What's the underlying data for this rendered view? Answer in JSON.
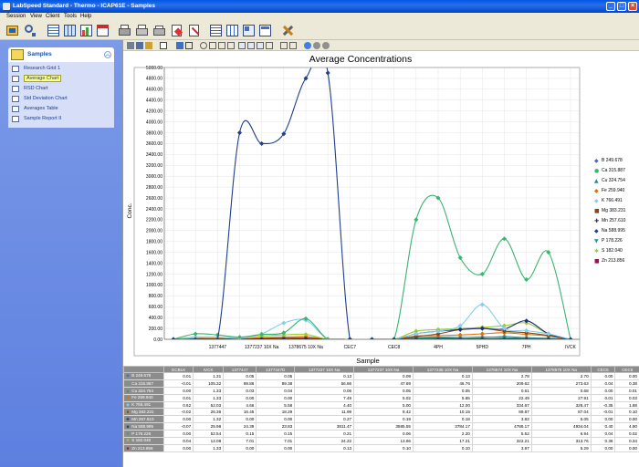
{
  "window": {
    "title": "LabSpeed Standard - Thermo - ICAP61E - Samples"
  },
  "menu": [
    "Session",
    "View",
    "Client",
    "Tools",
    "Help"
  ],
  "sidebar": {
    "title": "Samples",
    "items": [
      {
        "label": "Research Grid 1",
        "selected": false
      },
      {
        "label": "Average Chart",
        "selected": true
      },
      {
        "label": "RSD Chart",
        "selected": false
      },
      {
        "label": "Std Deviation Chart",
        "selected": false
      },
      {
        "label": "Averages Table",
        "selected": false
      },
      {
        "label": "Sample Report II",
        "selected": false
      }
    ]
  },
  "chart_data": {
    "type": "line",
    "title": "Average Concentrations",
    "xlabel": "Sample",
    "ylabel": "Conc.",
    "ylim": [
      0,
      5000
    ],
    "yticks": [
      "0.00",
      "200.00",
      "400.00",
      "600.00",
      "800.00",
      "1000.00",
      "1200.00",
      "1400.00",
      "1600.00",
      "1800.00",
      "2000.00",
      "2200.00",
      "2400.00",
      "2600.00",
      "2800.00",
      "3000.00",
      "3200.00",
      "3400.00",
      "3600.00",
      "3800.00",
      "4000.00",
      "4200.00",
      "4400.00",
      "4600.00",
      "4800.00",
      "5000.00"
    ],
    "xtick_labels": [
      {
        "i": 2,
        "label": "1377447"
      },
      {
        "i": 4,
        "label": "1377237 10X Na"
      },
      {
        "i": 6,
        "label": "1378675 10X Na"
      },
      {
        "i": 8,
        "label": "CEC7"
      },
      {
        "i": 10,
        "label": "CEC8"
      },
      {
        "i": 12,
        "label": "4PH"
      },
      {
        "i": 14,
        "label": "5PHD"
      },
      {
        "i": 16,
        "label": "7PH"
      },
      {
        "i": 18,
        "label": "IVCK"
      }
    ],
    "n_points": 19,
    "grid": true,
    "legend_position": "right",
    "series": [
      {
        "name": "B 249.678",
        "color": "#4169e1",
        "marker": "◆",
        "values": [
          0,
          0,
          0,
          0,
          0,
          0,
          0,
          0,
          0,
          0,
          0,
          0,
          0,
          0,
          0,
          0,
          0,
          0,
          0
        ]
      },
      {
        "name": "Ca 315.887",
        "color": "#3cb371",
        "marker": "●",
        "values": [
          0,
          100,
          80,
          40,
          90,
          120,
          380,
          0,
          0,
          0,
          0,
          2200,
          2600,
          1500,
          1200,
          1850,
          1100,
          1600,
          0
        ]
      },
      {
        "name": "Cu 324.754",
        "color": "#2e8b8b",
        "marker": "▲",
        "values": [
          0,
          10,
          10,
          5,
          10,
          15,
          20,
          0,
          0,
          0,
          0,
          30,
          40,
          35,
          30,
          50,
          30,
          20,
          0
        ]
      },
      {
        "name": "Fe 259.940",
        "color": "#e07000",
        "marker": "◆",
        "values": [
          0,
          15,
          15,
          10,
          30,
          40,
          50,
          0,
          0,
          0,
          0,
          60,
          70,
          80,
          100,
          120,
          90,
          60,
          0
        ]
      },
      {
        "name": "K 766.491",
        "color": "#87ceeb",
        "marker": "◆",
        "values": [
          0,
          30,
          40,
          20,
          100,
          300,
          350,
          0,
          0,
          0,
          0,
          100,
          150,
          250,
          640,
          200,
          160,
          100,
          0
        ]
      },
      {
        "name": "Mg 383.231",
        "color": "#8b4513",
        "marker": "■",
        "values": [
          0,
          8,
          8,
          5,
          15,
          20,
          25,
          0,
          0,
          0,
          0,
          50,
          100,
          180,
          200,
          150,
          120,
          70,
          0
        ]
      },
      {
        "name": "Mn 257.610",
        "color": "#1c2c80",
        "marker": "✚",
        "values": [
          0,
          0,
          0,
          0,
          0,
          0,
          0,
          0,
          0,
          0,
          0,
          100,
          150,
          180,
          200,
          190,
          340,
          100,
          0
        ]
      },
      {
        "name": "Na 588.995",
        "color": "#1f3f8f",
        "marker": "◆",
        "values": [
          0,
          0,
          0,
          3800,
          3600,
          3780,
          4800,
          4900,
          0,
          0,
          0,
          0,
          0,
          0,
          0,
          0,
          0,
          0,
          0
        ]
      },
      {
        "name": "P 178.226",
        "color": "#2a9d8f",
        "marker": "▼",
        "values": [
          0,
          5,
          5,
          5,
          10,
          10,
          10,
          0,
          0,
          0,
          0,
          20,
          25,
          30,
          40,
          30,
          20,
          10,
          0
        ]
      },
      {
        "name": "S 182.040",
        "color": "#9acd32",
        "marker": "✱",
        "values": [
          0,
          40,
          40,
          30,
          60,
          80,
          90,
          0,
          0,
          0,
          0,
          150,
          180,
          200,
          220,
          250,
          300,
          100,
          0
        ]
      },
      {
        "name": "Zn 213.856",
        "color": "#a01050",
        "marker": "■",
        "values": [
          0,
          2,
          2,
          2,
          3,
          3,
          4,
          0,
          0,
          0,
          0,
          5,
          6,
          7,
          8,
          7,
          6,
          4,
          0
        ]
      }
    ]
  },
  "table": {
    "columns": [
      "GCBLK",
      "IVCK",
      "1377447",
      "1377447D",
      "1377237 10X Na",
      "1377237 10X Na",
      "1377238 10X Na",
      "1378674 10X Na",
      "1378675 10X Na",
      "CEC5",
      "CEC6"
    ],
    "rows": [
      {
        "label": "B 249.678",
        "values": [
          "0.01",
          "1.31",
          "0.05",
          "0.05",
          "0.13",
          "0.09",
          "0.13",
          "2.78",
          "2.70",
          "0.00",
          "0.00"
        ]
      },
      {
        "label": "Ca 315.887",
        "values": [
          "-0.01",
          "105.32",
          "89.86",
          "89.38",
          "56.86",
          "47.69",
          "46.76",
          "209.62",
          "273.63",
          "0.04",
          "0.38"
        ]
      },
      {
        "label": "Cu 324.754",
        "values": [
          "0.00",
          "1.33",
          "0.03",
          "0.04",
          "0.06",
          "0.05",
          "0.05",
          "0.61",
          "0.68",
          "0.00",
          "0.01"
        ]
      },
      {
        "label": "Fe 259.940",
        "values": [
          "0.01",
          "1.33",
          "0.00",
          "0.00",
          "7.49",
          "5.02",
          "5.65",
          "22.49",
          "27.91",
          "0.01",
          "0.03"
        ]
      },
      {
        "label": "K 766.491",
        "values": [
          "0.62",
          "52.03",
          "4.66",
          "5.58",
          "4.40",
          "5.00",
          "12.00",
          "334.67",
          "326.47",
          "-0.35",
          "1.88"
        ]
      },
      {
        "label": "Mg 383.231",
        "values": [
          "-0.02",
          "26.36",
          "16.45",
          "18.29",
          "11.99",
          "8.42",
          "10.15",
          "89.87",
          "87.04",
          "-0.01",
          "0.10"
        ]
      },
      {
        "label": "Mn 257.610",
        "values": [
          "0.00",
          "1.32",
          "0.00",
          "0.00",
          "0.27",
          "0.19",
          "0.18",
          "3.82",
          "5.05",
          "0.00",
          "0.00"
        ]
      },
      {
        "label": "Na 588.995",
        "values": [
          "-0.07",
          "25.98",
          "24.39",
          "23.83",
          "3811.47",
          "3585.55",
          "3784.17",
          "4786.17",
          "4934.04",
          "0.40",
          "4.90"
        ]
      },
      {
        "label": "P 178.226",
        "values": [
          "0.00",
          "52.54",
          "0.15",
          "0.15",
          "0.21",
          "0.06",
          "2.20",
          "5.52",
          "6.94",
          "0.04",
          "0.02"
        ]
      },
      {
        "label": "S 182.040",
        "values": [
          "0.04",
          "12.08",
          "7.01",
          "7.01",
          "24.22",
          "13.66",
          "17.21",
          "322.21",
          "313.76",
          "0.36",
          "0.34"
        ]
      },
      {
        "label": "Zn 213.856",
        "values": [
          "0.00",
          "1.33",
          "0.00",
          "0.00",
          "0.13",
          "0.10",
          "0.10",
          "3.97",
          "5.29",
          "0.00",
          "0.00"
        ]
      }
    ]
  }
}
